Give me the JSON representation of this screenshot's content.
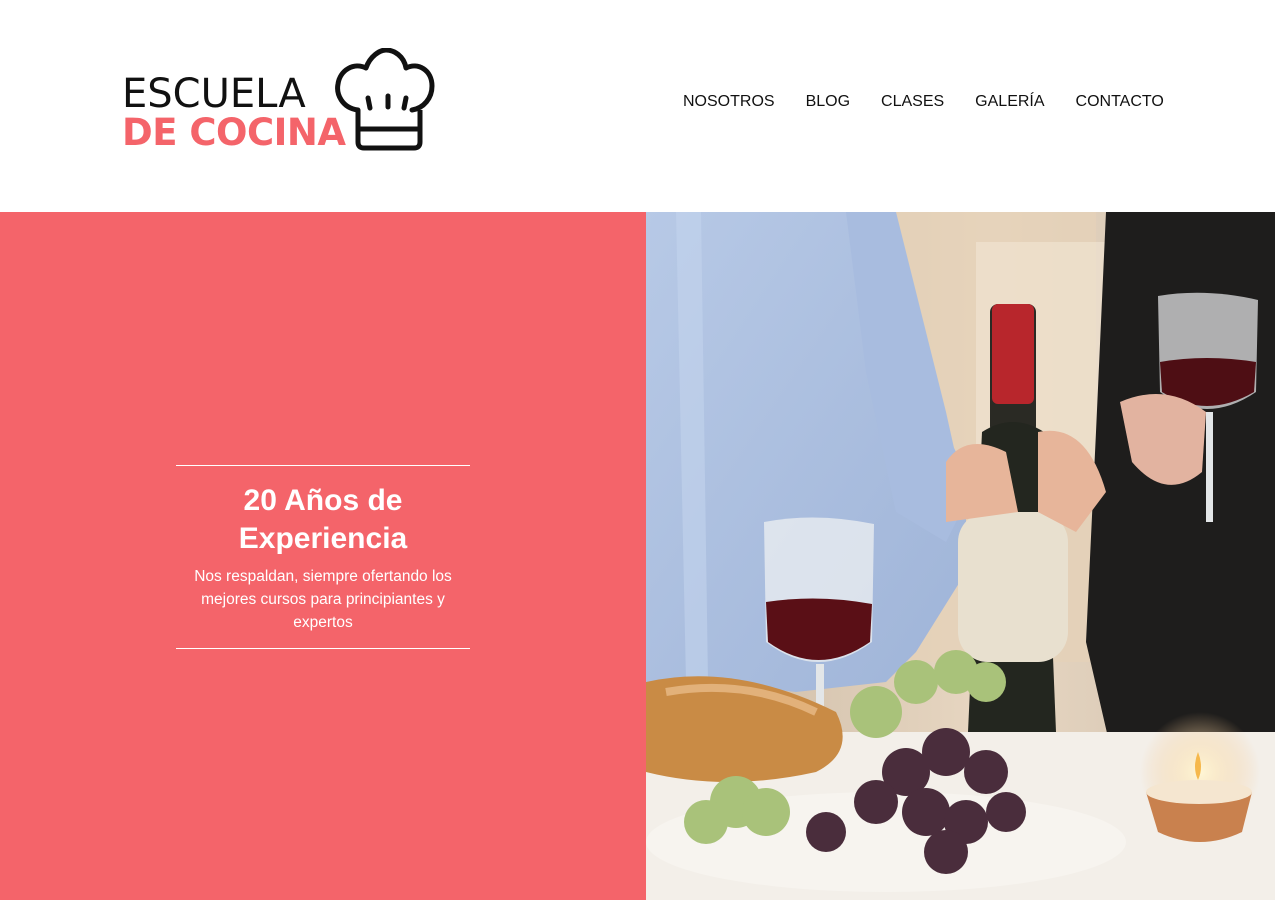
{
  "colors": {
    "brand_coral": "#f4646a",
    "logo_dark": "#111111"
  },
  "logo": {
    "line1": "ESCUELA",
    "line2": "DE COCINA",
    "icon": "chef-hat-icon"
  },
  "nav": {
    "items": [
      {
        "label": "NOSOTROS"
      },
      {
        "label": "BLOG"
      },
      {
        "label": "CLASES"
      },
      {
        "label": "GALERÍA"
      },
      {
        "label": "CONTACTO"
      }
    ]
  },
  "hero": {
    "title": "20 Años de Experiencia",
    "description": "Nos respaldan, siempre ofertando los mejores cursos para principiantes y expertos",
    "image": "people-wine-bottle-grapes-photo"
  }
}
